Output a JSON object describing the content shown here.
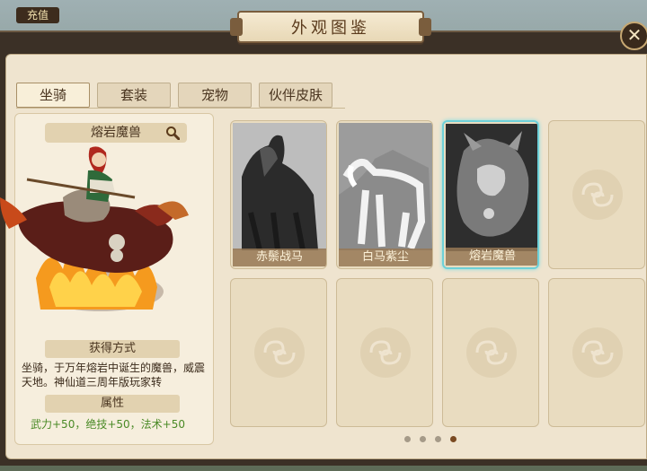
{
  "topbar": {
    "recharge_label": "充值"
  },
  "window": {
    "title": "外观图鉴",
    "close_label": "✕"
  },
  "tabs": [
    {
      "label": "坐骑",
      "active": true
    },
    {
      "label": "套装",
      "active": false
    },
    {
      "label": "宠物",
      "active": false
    },
    {
      "label": "伙伴皮肤",
      "active": false
    }
  ],
  "detail": {
    "mount_name": "熔岩魔兽",
    "obtain_header": "获得方式",
    "obtain_text": "坐骑，于万年熔岩中诞生的魔兽，威震天地。神仙道三周年版玩家转",
    "attr_header": "属性",
    "attr_text": "武力+50，绝技+50，法术+50"
  },
  "cards": [
    {
      "label": "赤鬃战马",
      "selected": false,
      "filled": true
    },
    {
      "label": "白马紫尘",
      "selected": false,
      "filled": true
    },
    {
      "label": "熔岩魔兽",
      "selected": true,
      "filled": true
    },
    {
      "label": "",
      "selected": false,
      "filled": false
    },
    {
      "label": "",
      "selected": false,
      "filled": false
    },
    {
      "label": "",
      "selected": false,
      "filled": false
    },
    {
      "label": "",
      "selected": false,
      "filled": false
    },
    {
      "label": "",
      "selected": false,
      "filled": false
    }
  ],
  "pagination": {
    "total": 4,
    "current": 4
  },
  "colors": {
    "accent_selected": "#6ed0d8",
    "stat_green": "#4a8a26",
    "title_brown": "#5a3a1c"
  }
}
